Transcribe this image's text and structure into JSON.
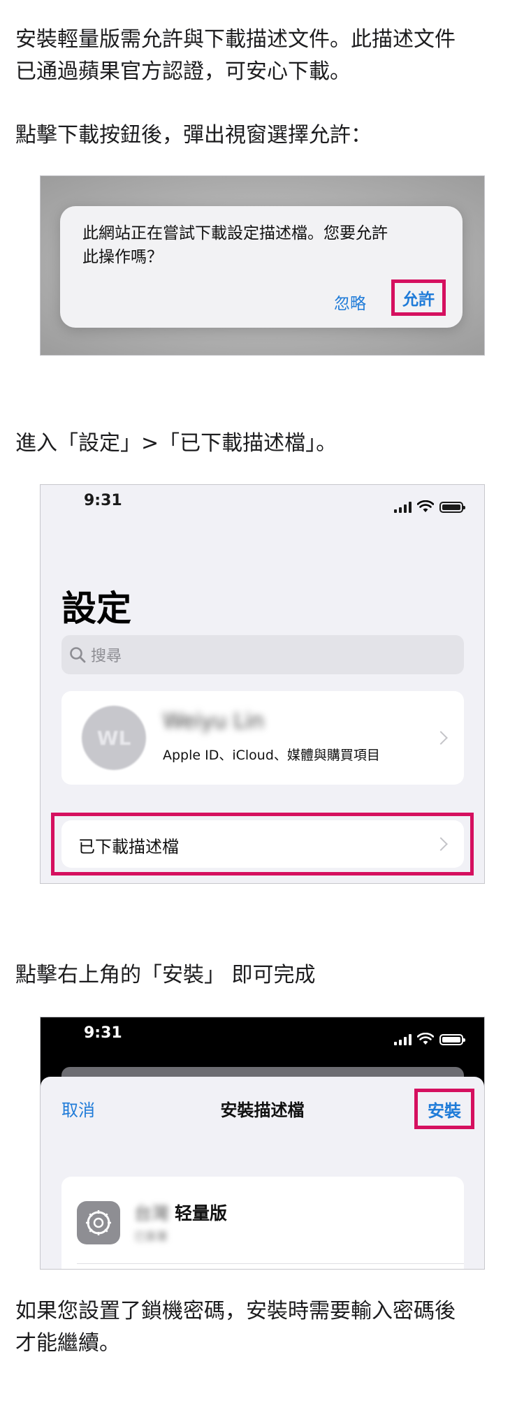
{
  "intro": {
    "line1": "安裝輕量版需允許與下載描述文件。此描述文件",
    "line2": "已通過蘋果官方認證，可安心下載。"
  },
  "step1_text": "點擊下載按鈕後，彈出視窗選擇允許：",
  "alert": {
    "message_line1": "此網站正在嘗試下載設定描述檔。您要允許",
    "message_line2": "此操作嗎？",
    "ignore_label": "忽略",
    "allow_label": "允許"
  },
  "step2_text": "進入「設定」>「已下載描述檔」。",
  "settings": {
    "time": "9:31",
    "title": "設定",
    "search_placeholder": "搜尋",
    "avatar_initials": "WL",
    "profile_name": "Weiyu Lin",
    "profile_sub": "Apple ID、iCloud、媒體與購買項目",
    "downloaded_profile_label": "已下載描述檔"
  },
  "step3_text": "點擊右上角的「安裝」 即可完成",
  "install": {
    "time": "9:31",
    "cancel_label": "取消",
    "title": "安裝描述檔",
    "install_label": "安裝",
    "profile_name_blurred": "台灣 ",
    "profile_name": "轻量版",
    "profile_sub": "已簽署"
  },
  "footer": {
    "line1": "如果您設置了鎖機密碼，安裝時需要輸入密碼後",
    "line2": "才能繼續。"
  },
  "colors": {
    "highlight": "#d5105f",
    "ios_blue": "#1f7bd8"
  }
}
